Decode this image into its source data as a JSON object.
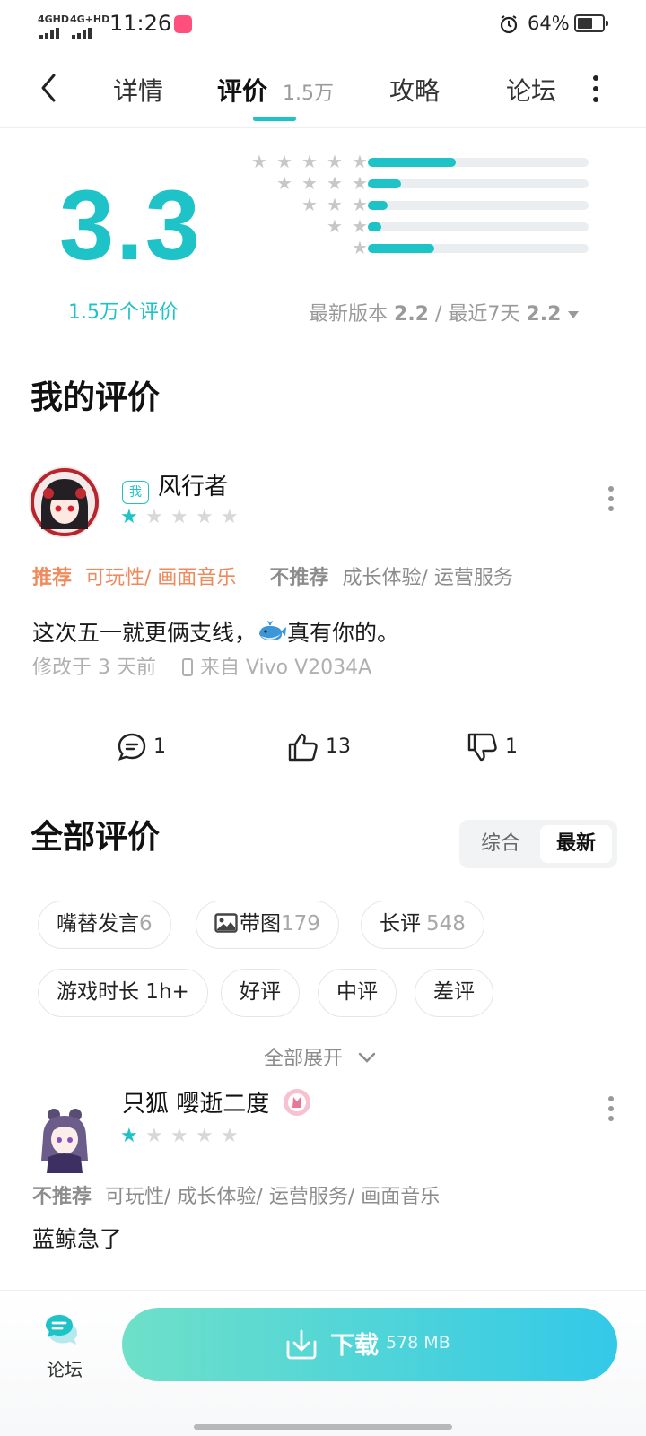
{
  "status_bar": {
    "signal1": "4GHD",
    "signal2": "4G+HD",
    "time": "11:26",
    "battery_pct": "64%"
  },
  "tabs": {
    "back_icon": "back-arrow-icon",
    "items": [
      {
        "label": "详情"
      },
      {
        "label": "评价",
        "count": "1.5万"
      },
      {
        "label": "攻略"
      },
      {
        "label": "论坛"
      }
    ],
    "more_icon": "more-vertical-icon",
    "active_index": 1
  },
  "rating_summary": {
    "score": "3.3",
    "count_label": "1.5万个评价",
    "distribution": [
      {
        "stars": 5,
        "fraction": 0.4
      },
      {
        "stars": 4,
        "fraction": 0.15
      },
      {
        "stars": 3,
        "fraction": 0.09
      },
      {
        "stars": 2,
        "fraction": 0.06
      },
      {
        "stars": 1,
        "fraction": 0.3
      }
    ],
    "version_label": "最新版本",
    "version_score": "2.2",
    "separator": "/",
    "recent_label": "最近7天",
    "recent_score": "2.2"
  },
  "my_review": {
    "section_title": "我的评价",
    "me_badge": "我",
    "username": "风行者",
    "stars": 1,
    "recommend_label": "推荐",
    "recommend_tags": "可玩性/ 画面音乐",
    "not_recommend_label": "不推荐",
    "not_recommend_tags": "成长体验/ 运营服务",
    "text_before": "这次五一就更俩支线，",
    "emoji_icon": "whale-emoji-icon",
    "text_after": "真有你的。",
    "modified": "修改于 3 天前",
    "device": "来自 Vivo V2034A",
    "comments": "1",
    "likes": "13",
    "dislikes": "1"
  },
  "all_reviews": {
    "section_title": "全部评价",
    "sort_options": [
      "综合",
      "最新"
    ],
    "sort_selected": "最新",
    "chips": [
      {
        "label": "嘴替发言",
        "count": "6"
      },
      {
        "label": "带图",
        "count": "179",
        "icon": "image-icon"
      },
      {
        "label": "长评",
        "count": "548"
      },
      {
        "label": "游戏时长 1h+"
      },
      {
        "label": "好评"
      },
      {
        "label": "中评"
      },
      {
        "label": "差评"
      }
    ],
    "expand_label": "全部展开",
    "reviews": [
      {
        "username": "只狐 嘤逝二度",
        "stars": 1,
        "not_recommend_label": "不推荐",
        "not_recommend_tags": "可玩性/ 成长体验/ 运营服务/ 画面音乐",
        "text": "蓝鲸急了"
      }
    ]
  },
  "bottom_bar": {
    "forum_label": "论坛",
    "download_label": "下载",
    "download_size": "578 MB"
  },
  "colors": {
    "accent": "#1ec3c8",
    "orange": "#f08a5d"
  }
}
